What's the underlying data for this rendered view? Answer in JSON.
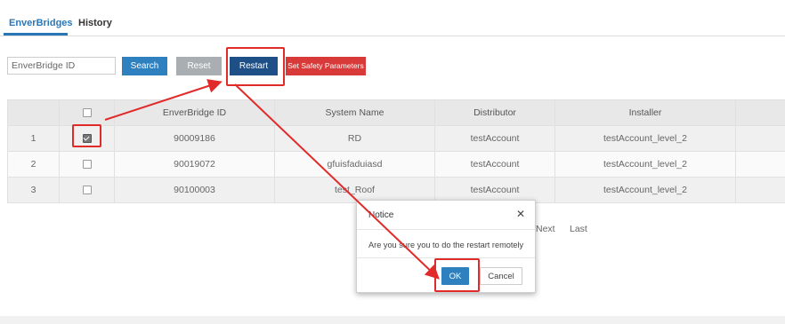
{
  "tabs": [
    {
      "label": "EnverBridges",
      "active": true
    },
    {
      "label": "History",
      "active": false
    }
  ],
  "filter": {
    "placeholder": "EnverBridge ID"
  },
  "toolbar": {
    "search_label": "Search",
    "reset_label": "Reset",
    "restart_label": "Restart",
    "safety_label": "Set Safety Parameters"
  },
  "table": {
    "headers": [
      "",
      "",
      "EnverBridge ID",
      "System Name",
      "Distributor",
      "Installer",
      ""
    ],
    "rows": [
      {
        "index": "1",
        "checked": true,
        "id": "90009186",
        "system_name": "RD",
        "distributor": "testAccount",
        "installer": "testAccount_level_2"
      },
      {
        "index": "2",
        "checked": false,
        "id": "90019072",
        "system_name": "gfuisfaduiasd",
        "distributor": "testAccount",
        "installer": "testAccount_level_2"
      },
      {
        "index": "3",
        "checked": false,
        "id": "90100003",
        "system_name": "test_Roof",
        "distributor": "testAccount",
        "installer": "testAccount_level_2"
      }
    ]
  },
  "pagination": {
    "next_label": "Next",
    "last_label": "Last"
  },
  "dialog": {
    "title": "Notice",
    "close_icon": "close-icon",
    "message": "Are you sure you to do the restart remotely",
    "ok_label": "OK",
    "cancel_label": "Cancel"
  },
  "colors": {
    "primary": "#2e80bf",
    "restart": "#1f4f87",
    "danger": "#d83a3a",
    "annotation": "#e12a2a"
  }
}
